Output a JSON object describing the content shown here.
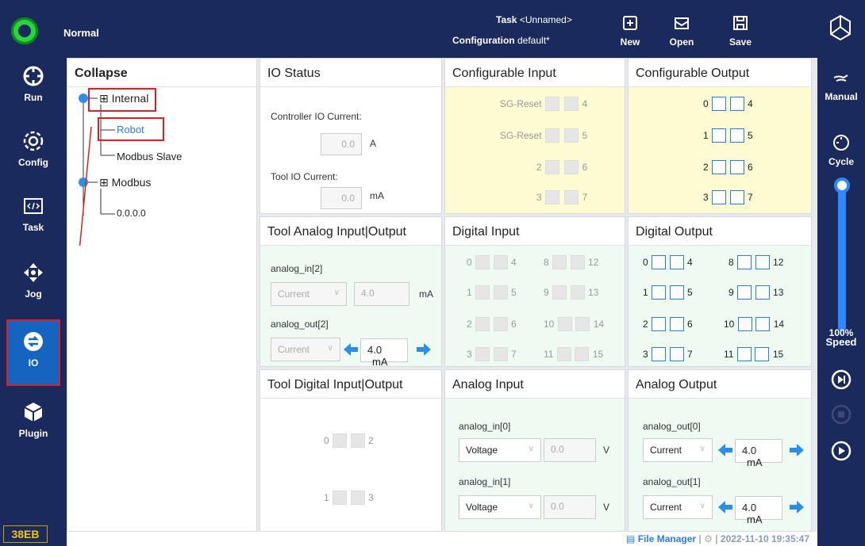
{
  "topbar": {
    "mode": "Normal",
    "task_label": "Task",
    "task_value": "<Unnamed>",
    "config_label": "Configuration",
    "config_value": "default*",
    "new_label": "New",
    "open_label": "Open",
    "save_label": "Save"
  },
  "sidebar": {
    "items": [
      {
        "label": "Run",
        "icon": "run-icon"
      },
      {
        "label": "Config",
        "icon": "gear-icon"
      },
      {
        "label": "Task",
        "icon": "code-icon"
      },
      {
        "label": "Jog",
        "icon": "move-icon"
      },
      {
        "label": "IO",
        "icon": "io-icon"
      },
      {
        "label": "Plugin",
        "icon": "cube-icon"
      }
    ],
    "active": "IO",
    "device_badge": "38EB"
  },
  "rightbar": {
    "manual_label": "Manual",
    "cycle_label": "Cycle",
    "speed_value": "100%",
    "speed_label": "Speed",
    "speed_fraction": 1.0
  },
  "tree": {
    "title": "Collapse",
    "internal": "Internal",
    "robot": "Robot",
    "modbus_slave": "Modbus Slave",
    "modbus": "Modbus",
    "ip": "0.0.0.0"
  },
  "io_status": {
    "title": "IO Status",
    "controller_label": "Controller IO Current:",
    "controller_value": "0.0",
    "controller_unit": "A",
    "tool_label": "Tool IO Current:",
    "tool_value": "0.0",
    "tool_unit": "mA"
  },
  "config_input": {
    "title": "Configurable Input",
    "rows": [
      {
        "a": "SG-Reset",
        "b": "4"
      },
      {
        "a": "SG-Reset",
        "b": "5"
      },
      {
        "a": "2",
        "b": "6"
      },
      {
        "a": "3",
        "b": "7"
      }
    ]
  },
  "config_output": {
    "title": "Configurable Output",
    "rows": [
      {
        "a": "0",
        "b": "4"
      },
      {
        "a": "1",
        "b": "5"
      },
      {
        "a": "2",
        "b": "6"
      },
      {
        "a": "3",
        "b": "7"
      }
    ]
  },
  "tool_analog": {
    "title": "Tool Analog Input|Output",
    "in_label": "analog_in[2]",
    "in_mode": "Current",
    "in_value": "4.0",
    "in_unit": "mA",
    "out_label": "analog_out[2]",
    "out_mode": "Current",
    "out_value": "4.0",
    "out_unit": "mA"
  },
  "digital_input": {
    "title": "Digital Input",
    "rows": [
      {
        "a": "0",
        "b": "4",
        "c": "8",
        "d": "12"
      },
      {
        "a": "1",
        "b": "5",
        "c": "9",
        "d": "13"
      },
      {
        "a": "2",
        "b": "6",
        "c": "10",
        "d": "14"
      },
      {
        "a": "3",
        "b": "7",
        "c": "11",
        "d": "15"
      }
    ]
  },
  "digital_output": {
    "title": "Digital Output",
    "rows": [
      {
        "a": "0",
        "b": "4",
        "c": "8",
        "d": "12"
      },
      {
        "a": "1",
        "b": "5",
        "c": "9",
        "d": "13"
      },
      {
        "a": "2",
        "b": "6",
        "c": "10",
        "d": "14"
      },
      {
        "a": "3",
        "b": "7",
        "c": "11",
        "d": "15"
      }
    ]
  },
  "tool_digital": {
    "title": "Tool Digital Input|Output",
    "rows": [
      {
        "a": "0",
        "b": "2"
      },
      {
        "a": "1",
        "b": "3"
      }
    ]
  },
  "analog_input": {
    "title": "Analog Input",
    "in0_label": "analog_in[0]",
    "in0_mode": "Voltage",
    "in0_value": "0.0",
    "in0_unit": "V",
    "in1_label": "analog_in[1]",
    "in1_mode": "Voltage",
    "in1_value": "0.0",
    "in1_unit": "V"
  },
  "analog_output": {
    "title": "Analog Output",
    "out0_label": "analog_out[0]",
    "out0_mode": "Current",
    "out0_value": "4.0",
    "out0_unit": "mA",
    "out1_label": "analog_out[1]",
    "out1_mode": "Current",
    "out1_value": "4.0",
    "out1_unit": "mA"
  },
  "footer": {
    "file_manager": "File Manager",
    "datetime": "2022-11-10 19:35:47"
  },
  "colors": {
    "nav_bg": "#1a2a5c",
    "active": "#1565c0",
    "accent": "#2b7de9",
    "highlight": "#e02020",
    "status_ok": "#2bd43c"
  }
}
